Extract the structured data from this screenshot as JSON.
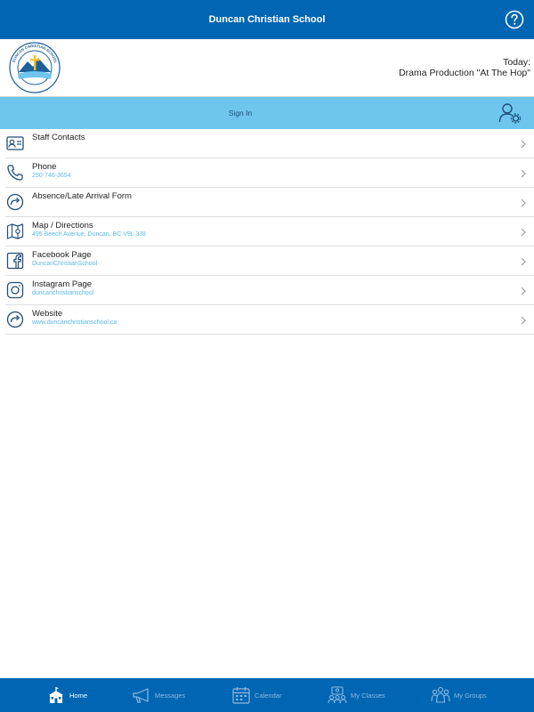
{
  "topbar": {
    "title": "Duncan Christian School",
    "help_icon": "question-circle-icon"
  },
  "header": {
    "logo_text": "DUNCAN CHRISTIAN SCHOOL",
    "today_label": "Today:",
    "today_event": "Drama Production \"At The Hop\""
  },
  "signin": {
    "label": "Sign In",
    "icon": "user-settings-icon"
  },
  "list": [
    {
      "label": "Staff Contacts",
      "sub": "",
      "icon": "contact-card-icon"
    },
    {
      "label": "Phone",
      "sub": "250-746-3654",
      "icon": "phone-icon"
    },
    {
      "label": "Absence/Late Arrival Form",
      "sub": "",
      "icon": "arrow-circle-icon"
    },
    {
      "label": "Map / Directions",
      "sub": "495 Beech Avenue, Duncan, BC V9L 3J8",
      "icon": "map-icon"
    },
    {
      "label": "Facebook Page",
      "sub": "DuncanChristianSchool",
      "icon": "facebook-icon"
    },
    {
      "label": "Instagram Page",
      "sub": "duncanchristianschool",
      "icon": "instagram-icon"
    },
    {
      "label": "Website",
      "sub": "www.duncanchristianschool.ca",
      "icon": "arrow-circle-icon"
    }
  ],
  "tabs": [
    {
      "label": "Home",
      "active": true,
      "icon": "school-icon"
    },
    {
      "label": "Messages",
      "active": false,
      "icon": "megaphone-icon"
    },
    {
      "label": "Calendar",
      "active": false,
      "icon": "calendar-icon"
    },
    {
      "label": "My Classes",
      "active": false,
      "icon": "classes-icon"
    },
    {
      "label": "My Groups",
      "active": false,
      "icon": "groups-icon"
    }
  ],
  "colors": {
    "primary": "#0066b3",
    "signin_bar": "#6ec6ef",
    "subtext": "#5bb8ea",
    "icon": "#1f4e7a"
  }
}
